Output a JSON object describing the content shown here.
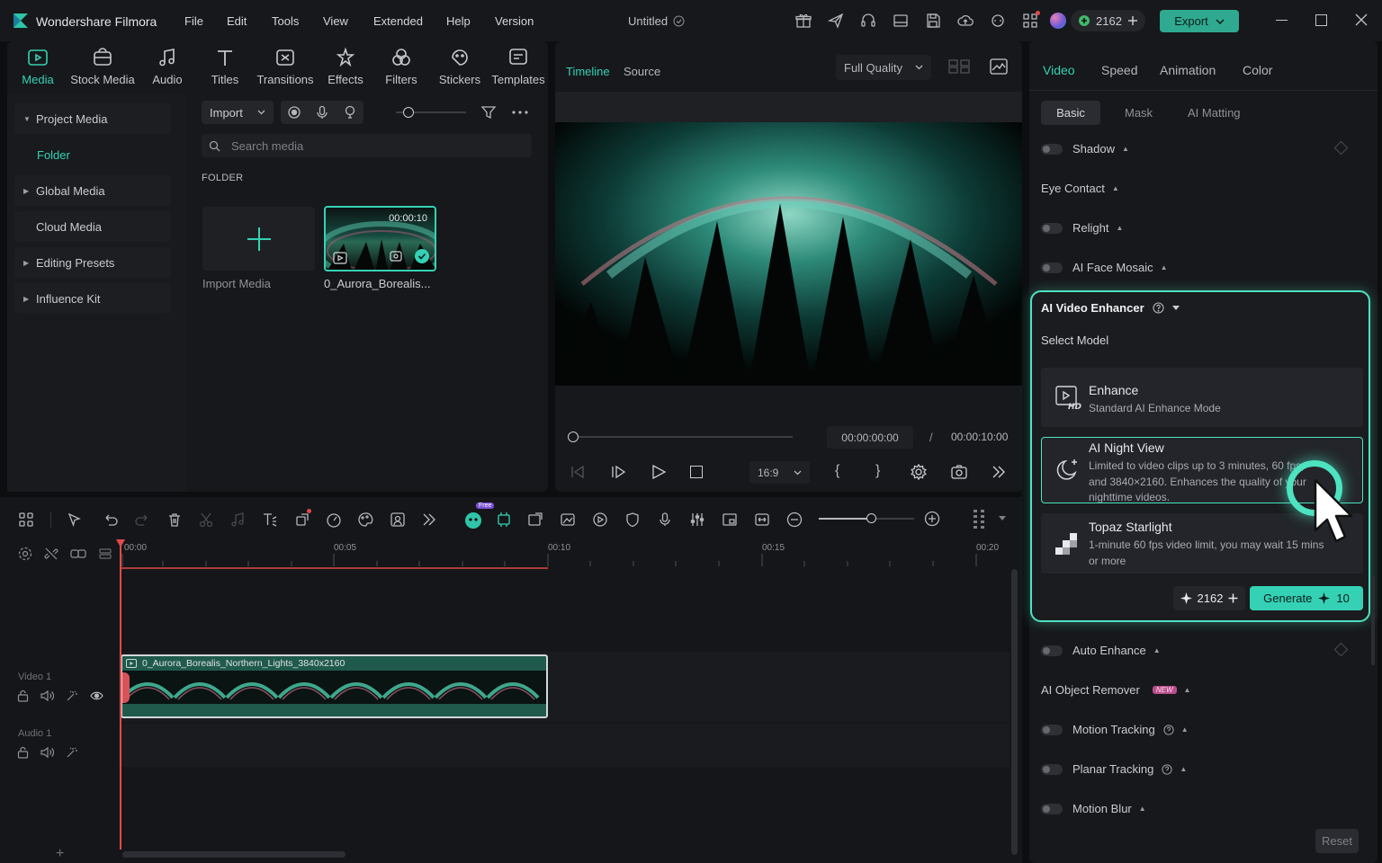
{
  "app": {
    "name": "Wondershare Filmora",
    "menu": [
      "File",
      "Edit",
      "Tools",
      "View",
      "Extended",
      "Help",
      "Version"
    ],
    "project_title": "Untitled",
    "credits": "2162",
    "export_label": "Export"
  },
  "toolbar": {
    "tabs": [
      {
        "label": "Media",
        "icon": "media-icon"
      },
      {
        "label": "Stock Media",
        "icon": "stock-media-icon"
      },
      {
        "label": "Audio",
        "icon": "audio-icon"
      },
      {
        "label": "Titles",
        "icon": "titles-icon"
      },
      {
        "label": "Transitions",
        "icon": "transitions-icon"
      },
      {
        "label": "Effects",
        "icon": "effects-icon"
      },
      {
        "label": "Filters",
        "icon": "filters-icon"
      },
      {
        "label": "Stickers",
        "icon": "stickers-icon"
      },
      {
        "label": "Templates",
        "icon": "templates-icon"
      }
    ],
    "active_tab": "Media"
  },
  "media_sidebar": {
    "items": [
      {
        "label": "Project Media",
        "expandable": true,
        "expanded": true
      },
      {
        "label": "Folder",
        "active": true
      },
      {
        "label": "Global Media",
        "expandable": true
      },
      {
        "label": "Cloud Media"
      },
      {
        "label": "Editing Presets",
        "expandable": true
      },
      {
        "label": "Influence Kit",
        "expandable": true
      }
    ]
  },
  "media_panel": {
    "import_label": "Import",
    "search_placeholder": "Search media",
    "section_label": "FOLDER",
    "import_tile_label": "Import Media",
    "clip": {
      "name": "0_Aurora_Borealis...",
      "duration": "00:00:10"
    }
  },
  "player": {
    "tabs": [
      "Timeline",
      "Source"
    ],
    "quality": "Full Quality",
    "current_time": "00:00:00:00",
    "separator": "/",
    "total_time": "00:00:10:00",
    "aspect_ratio": "16:9",
    "brace_open": "{",
    "brace_close": "}"
  },
  "timeline": {
    "free_badge": "Free",
    "ticks": [
      "00:00",
      "00:05",
      "00:10",
      "00:15",
      "00:20"
    ],
    "tracks": [
      {
        "name": "Video 1"
      },
      {
        "name": "Audio 1"
      }
    ],
    "clip_name": "0_Aurora_Borealis_Northern_Lights_3840x2160",
    "add_track": "+"
  },
  "properties": {
    "tabs": [
      "Video",
      "Speed",
      "Animation",
      "Color"
    ],
    "subtabs": [
      "Basic",
      "Mask",
      "AI Matting"
    ],
    "rows_top": [
      {
        "label": "Shadow",
        "toggle": true
      },
      {
        "label": "Eye Contact",
        "toggle": false
      },
      {
        "label": "Relight",
        "toggle": true
      },
      {
        "label": "AI Face Mosaic",
        "toggle": true
      }
    ],
    "enhancer": {
      "title": "AI Video Enhancer",
      "select_model": "Select Model",
      "models": [
        {
          "title": "Enhance",
          "desc": "Standard AI Enhance Mode",
          "icon": "hd-play-icon"
        },
        {
          "title": "AI Night View",
          "desc": "Limited to video clips up to 3 minutes, 60 fps, and 3840×2160. Enhances the quality of your nighttime videos.",
          "icon": "moon-sparkle-icon",
          "selected": true
        },
        {
          "title": "Topaz Starlight",
          "desc": "1-minute 60 fps video limit, you may wait 15 mins or more",
          "icon": "topaz-icon"
        }
      ],
      "credits": "2162",
      "generate_label": "Generate",
      "generate_cost": "10"
    },
    "rows_bottom": [
      {
        "label": "Auto Enhance",
        "toggle": true
      },
      {
        "label": "AI Object Remover",
        "toggle": false,
        "badge": "NEW"
      },
      {
        "label": "Motion Tracking",
        "toggle": true,
        "help": true
      },
      {
        "label": "Planar Tracking",
        "toggle": true,
        "help": true
      },
      {
        "label": "Motion Blur",
        "toggle": true
      }
    ],
    "reset_label": "Reset"
  },
  "colors": {
    "accent": "#35d1b5",
    "export_bg": "#2fa98f",
    "panel": "#17181b",
    "highlight_border": "#4de3c0",
    "playhead": "#e04a4a"
  }
}
